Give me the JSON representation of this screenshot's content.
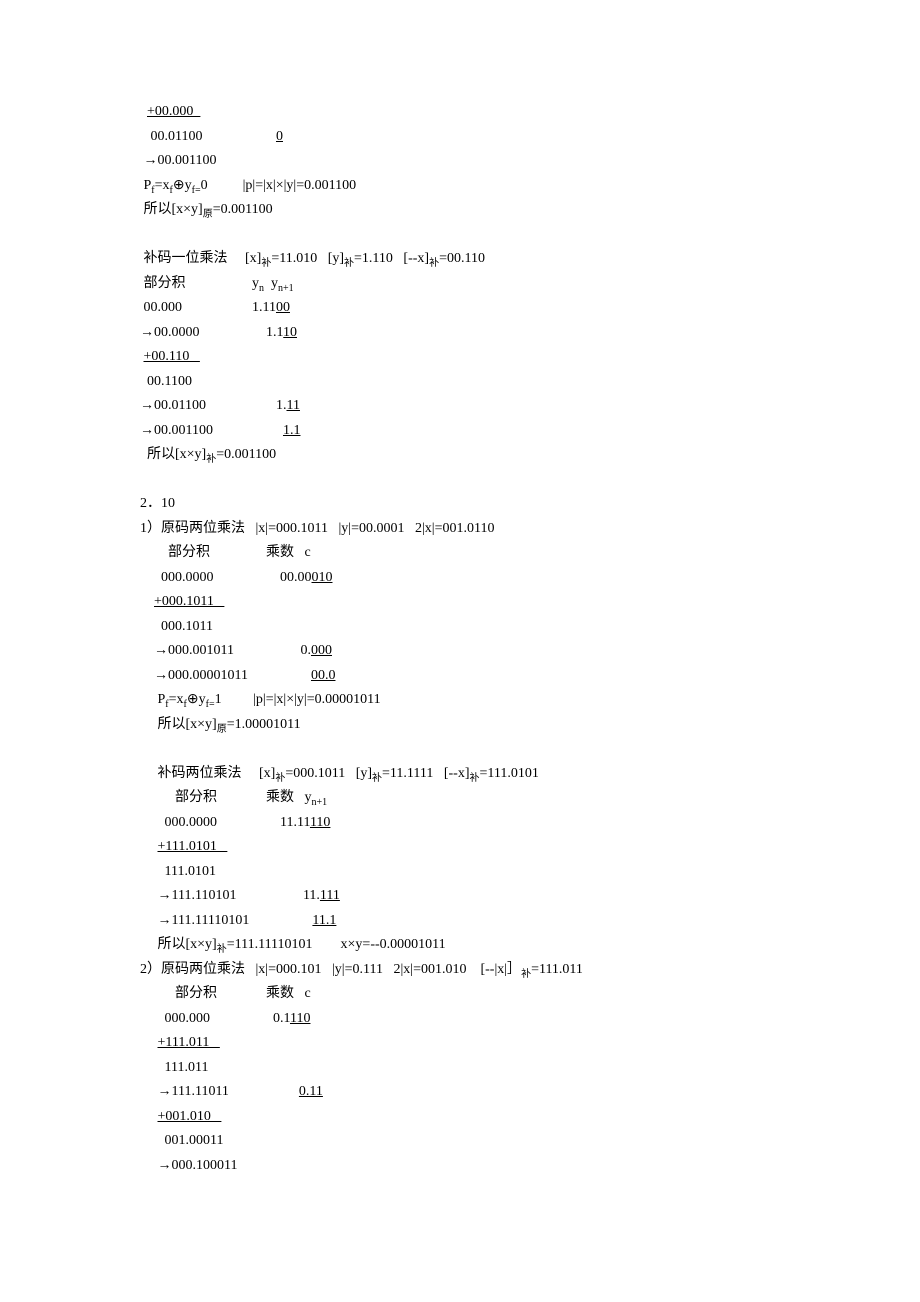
{
  "s1": {
    "l1a": "  ",
    "l1b": "+00.000  ",
    "l2a": "   00.01100                     ",
    "l2b": "0",
    "l3": "00.001100",
    "l4a": " P",
    "l4b": "=x",
    "l4c": "⊕y",
    "l4d": "0          |p|=|x|×|y|=0.001100",
    "l4sub1": "f",
    "l4sub2": "f",
    "l4sub3": "f=",
    "l5a": " 所以[x×y]",
    "l5sub": "原",
    "l5b": "=0.001100"
  },
  "s2": {
    "l1a": " 补码一位乘法     [x]",
    "l1sub1": "补",
    "l1b": "=11.010   [y]",
    "l1sub2": "补",
    "l1c": "=1.110   [--x]",
    "l1sub3": "补",
    "l1d": "=00.110",
    "l2a": " 部分积                   y",
    "l2sub1": "n",
    "l2b": "  y",
    "l2sub2": "n+1",
    "l3a": " 00.000                    1.11",
    "l3b": "00",
    "l4a": "00.0000                   1.1",
    "l4b": "10",
    "l5a": " ",
    "l5b": "+00.110   ",
    "l6": "  00.1100",
    "l7a": "00.01100                    1.",
    "l7b": "11",
    "l8a": "00.001100                    ",
    "l8b": "1.1",
    "l9a": "  所以[x×y]",
    "l9sub": "补",
    "l9b": "=0.001100"
  },
  "s3": {
    "h1": "2．10",
    "h2": "1）原码两位乘法   |x|=000.1011   |y|=00.0001   2|x|=001.0110",
    "l1": "        部分积                乘数   c",
    "l2a": "      000.0000                   00.00",
    "l2b": "010",
    "l3a": "    ",
    "l3b": "+000.1011   ",
    "l4": "      000.1011",
    "l5a": "    →000.001011                   0.",
    "l5b": "000",
    "l6a": "    →000.00001011                  ",
    "l6b": "00.0",
    "l7a": "     P",
    "l7b": "=x",
    "l7c": "⊕y",
    "l7d": "1         |p|=|x|×|y|=0.00001011",
    "l7sub1": "f",
    "l7sub2": "f",
    "l7sub3": "f=",
    "l8a": "     所以[x×y]",
    "l8sub": "原",
    "l8b": "=1.00001011"
  },
  "s4": {
    "l1a": "     补码两位乘法     [x]",
    "l1sub1": "补",
    "l1b": "=000.1011   [y]",
    "l1sub2": "补",
    "l1c": "=11.1111   [--x]",
    "l1sub3": "补",
    "l1d": "=111.0101",
    "l2a": "          部分积              乘数   y",
    "l2sub": "n+1",
    "l3a": "       000.0000                  11.11",
    "l3b": "110",
    "l4a": "     ",
    "l4b": "+111.0101   ",
    "l5": "       111.0101",
    "l6a": "     →111.110101                   11.",
    "l6b": "111",
    "l7a": "     →111.11110101                  ",
    "l7b": "11.1",
    "l8a": "     所以[x×y]",
    "l8sub": "补",
    "l8b": "=111.11110101        x×y=--0.00001011"
  },
  "s5": {
    "h": "2）原码两位乘法   |x|=000.101   |y|=0.111   2|x|=001.010    [--|x|］",
    "hsub": "补",
    "hb": "=111.011",
    "l1": "          部分积              乘数   c",
    "l2a": "       000.000                  0.1",
    "l2b": "110",
    "l3a": "     ",
    "l3b": "+111.011   ",
    "l4": "       111.011",
    "l5a": "     →111.11011                    ",
    "l5b": "0.11",
    "l6a": "     ",
    "l6b": "+001.010   ",
    "l7": "       001.00011",
    "l8": "     →000.100011"
  }
}
